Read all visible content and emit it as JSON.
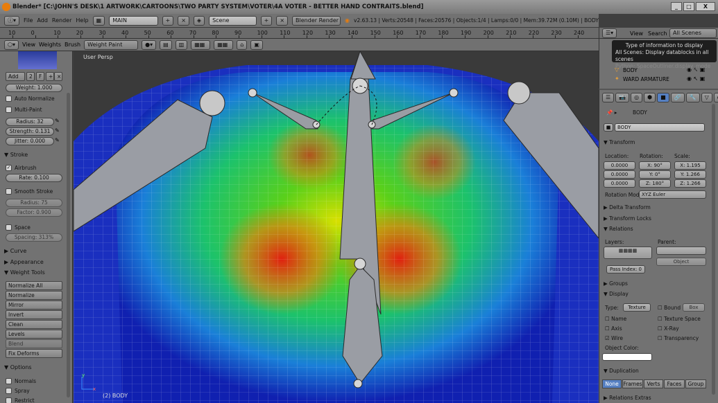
{
  "window": {
    "title": "Blender* [C:\\JOHN'S DESK\\1 ARTWORK\\CARTOONS\\TWO PARTY SYSTEM\\VOTER\\4A VOTER - BETTER HAND CONTRAITS.blend]",
    "controls": [
      "_",
      "□",
      "X"
    ]
  },
  "infobar": {
    "menus": [
      "File",
      "Add",
      "Render",
      "Help"
    ],
    "screen": "MAIN",
    "scene": "Scene",
    "engine": "Blender Render",
    "stats": "v2.63.13 | Verts:20548 | Faces:20576 | Objects:1/4 | Lamps:0/0 | Mem:39.72M (0.10M) | BODY"
  },
  "timeline_ruler": [
    "10",
    "0",
    "10",
    "20",
    "30",
    "40",
    "50",
    "60",
    "70",
    "80",
    "90",
    "100",
    "110",
    "120",
    "130",
    "140",
    "150",
    "160",
    "170",
    "180",
    "190",
    "200",
    "210",
    "220",
    "230",
    "240"
  ],
  "viewport_header": {
    "menus": [
      "View",
      "Weights",
      "Brush"
    ],
    "mode": "Weight Paint"
  },
  "viewport": {
    "view_label": "User Persp",
    "object_label": "(2) BODY",
    "axis_x": "x",
    "axis_y": "y"
  },
  "tool_panel": {
    "add_label": "Add",
    "brush_users": "2",
    "fake_user": "F",
    "weight": "Weight: 1.000",
    "auto_normalize": "Auto Normalize",
    "multi_paint": "Multi-Paint",
    "radius": "Radius: 32",
    "strength": "Strength: 0.131",
    "jitter": "Jitter: 0.000",
    "stroke_header": "Stroke",
    "airbrush": "Airbrush",
    "rate": "Rate: 0.100",
    "smooth_stroke": "Smooth Stroke",
    "smooth_radius": "Radius: 75",
    "smooth_factor": "Factor: 0.900",
    "space": "Space",
    "spacing": "Spacing: 313%",
    "curve_header": "Curve",
    "appearance_header": "Appearance",
    "weight_tools_header": "Weight Tools",
    "weight_tools": [
      "Normalize All",
      "Normalize",
      "Mirror",
      "Invert",
      "Clean",
      "Levels",
      "Blend",
      "Fix Deforms"
    ],
    "options_header": "Options",
    "normals": "Normals",
    "spray": "Spray",
    "restrict": "Restrict"
  },
  "outliner": {
    "view": "View",
    "search": "Search",
    "display_mode": "All Scenes",
    "rows": [
      "BODY",
      "WARD ARMATURE"
    ]
  },
  "tooltip": {
    "title": "Type of information to display",
    "desc": "All Scenes: Display datablocks in all scenes",
    "python": "Python: SpaceOutliner.display_mode"
  },
  "properties": {
    "breadcrumb": "BODY",
    "object_name": "BODY",
    "transform_header": "Transform",
    "location_label": "Location:",
    "rotation_label": "Rotation:",
    "scale_label": "Scale:",
    "location": [
      "0.0000",
      "0.0000",
      "0.0000"
    ],
    "rotation": [
      "X: 90°",
      "Y: 0°",
      "Z: 180°"
    ],
    "scale": [
      "X: 1.195",
      "Y: 1.266",
      "Z: 1.266"
    ],
    "rotation_mode_label": "Rotation Mod",
    "rotation_mode": "XYZ Euler",
    "delta_transform": "Delta Transform",
    "transform_locks": "Transform Locks",
    "relations": "Relations",
    "layers_label": "Layers:",
    "parent_label": "Parent:",
    "parent_type": "Object",
    "pass_index": "Pass Index: 0",
    "groups": "Groups",
    "display": "Display",
    "type_label": "Type:",
    "display_type": "Texture",
    "bounds": "Bound",
    "bounds_type": "Box",
    "name": "Name",
    "texture_space": "Texture Space",
    "axis": "Axis",
    "xray": "X-Ray",
    "wire": "Wire",
    "transparency": "Transparency",
    "object_color": "Object Color:",
    "duplication": "Duplication",
    "dup_modes": [
      "None",
      "Frames",
      "Verts",
      "Faces",
      "Group"
    ],
    "relations_extras": "Relations Extras"
  }
}
